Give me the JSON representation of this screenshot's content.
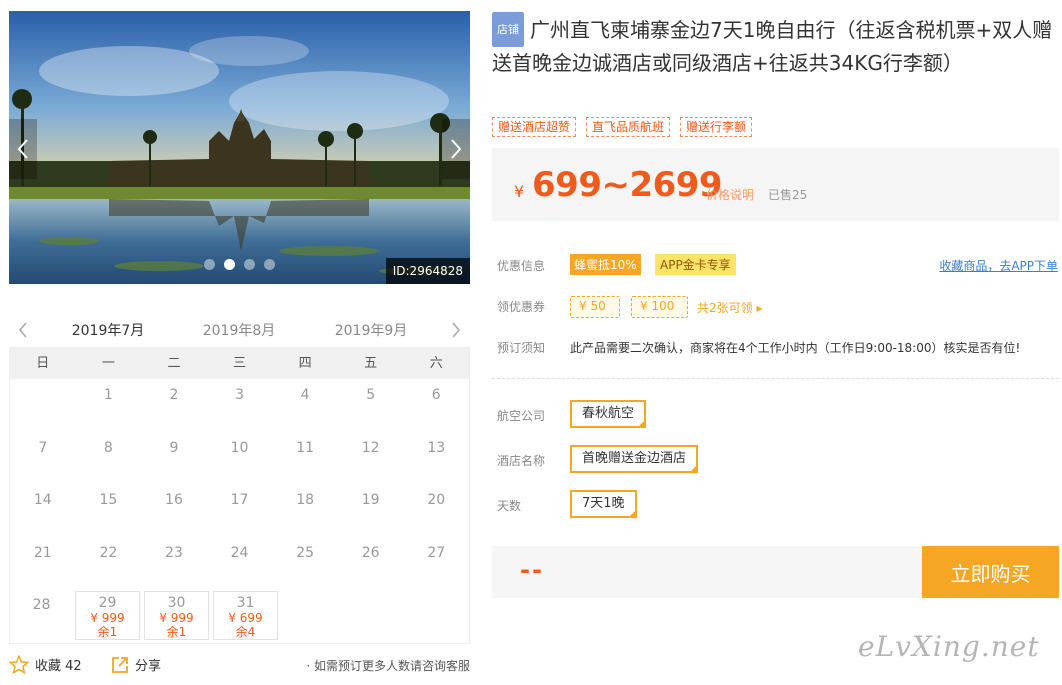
{
  "gallery": {
    "photo_id": "ID:2964828",
    "dots": 4,
    "active_dot": 1
  },
  "calendar": {
    "months": [
      "2019年7月",
      "2019年8月",
      "2019年9月"
    ],
    "active_month": 0,
    "weekdays": [
      "日",
      "一",
      "二",
      "三",
      "四",
      "五",
      "六"
    ],
    "rows": [
      [
        {
          "d": ""
        },
        {
          "d": "1"
        },
        {
          "d": "2"
        },
        {
          "d": "3"
        },
        {
          "d": "4"
        },
        {
          "d": "5"
        },
        {
          "d": "6"
        }
      ],
      [
        {
          "d": "7"
        },
        {
          "d": "8"
        },
        {
          "d": "9"
        },
        {
          "d": "10"
        },
        {
          "d": "11"
        },
        {
          "d": "12"
        },
        {
          "d": "13"
        }
      ],
      [
        {
          "d": "14"
        },
        {
          "d": "15"
        },
        {
          "d": "16"
        },
        {
          "d": "17"
        },
        {
          "d": "18"
        },
        {
          "d": "19"
        },
        {
          "d": "20"
        }
      ],
      [
        {
          "d": "21"
        },
        {
          "d": "22"
        },
        {
          "d": "23"
        },
        {
          "d": "24"
        },
        {
          "d": "25"
        },
        {
          "d": "26"
        },
        {
          "d": "27"
        }
      ],
      [
        {
          "d": "28"
        },
        {
          "d": "29",
          "price": "¥ 999",
          "left": "余1"
        },
        {
          "d": "30",
          "price": "¥ 999",
          "left": "余1"
        },
        {
          "d": "31",
          "price": "¥ 699",
          "left": "余4"
        },
        {
          "d": ""
        },
        {
          "d": ""
        },
        {
          "d": ""
        }
      ]
    ]
  },
  "actions": {
    "favorite_label": "收藏 42",
    "share_label": "分享",
    "consult_text": "· 如需预订更多人数请咨询客服"
  },
  "product": {
    "shop_badge": "店铺",
    "title": "广州直飞柬埔寨金边7天1晚自由行（往返含税机票+双人赠送首晚金边诚酒店或同级酒店+往返共34KG行李额）",
    "tags": [
      "赠送酒店超赞",
      "直飞品质航班",
      "赠送行李额"
    ],
    "price_symbol": "¥",
    "price_range": "699~2699",
    "price_explain": "价格说明",
    "sold": "已售25"
  },
  "info": {
    "promo_label": "优惠信息",
    "promo_1": "蜂蜜抵10%",
    "promo_2": "APP金卡专享",
    "fav_app_link": "收藏商品，去APP下单",
    "coupon_label": "领优惠券",
    "coupon_1": "¥ 50",
    "coupon_2": "¥ 100",
    "coupon_more": "共2张可领 ▸",
    "notice_label": "预订须知",
    "notice_text": "此产品需要二次确认，商家将在4个工作小时内（工作日9:00-18:00）核实是否有位!"
  },
  "options": {
    "airline_label": "航空公司",
    "airline_value": "春秋航空",
    "hotel_label": "酒店名称",
    "hotel_value": "首晚赠送金边酒店",
    "days_label": "天数",
    "days_value": "7天1晚"
  },
  "buy": {
    "total": "--",
    "button_label": "立即购买"
  },
  "watermark": "eLvXing.net"
}
